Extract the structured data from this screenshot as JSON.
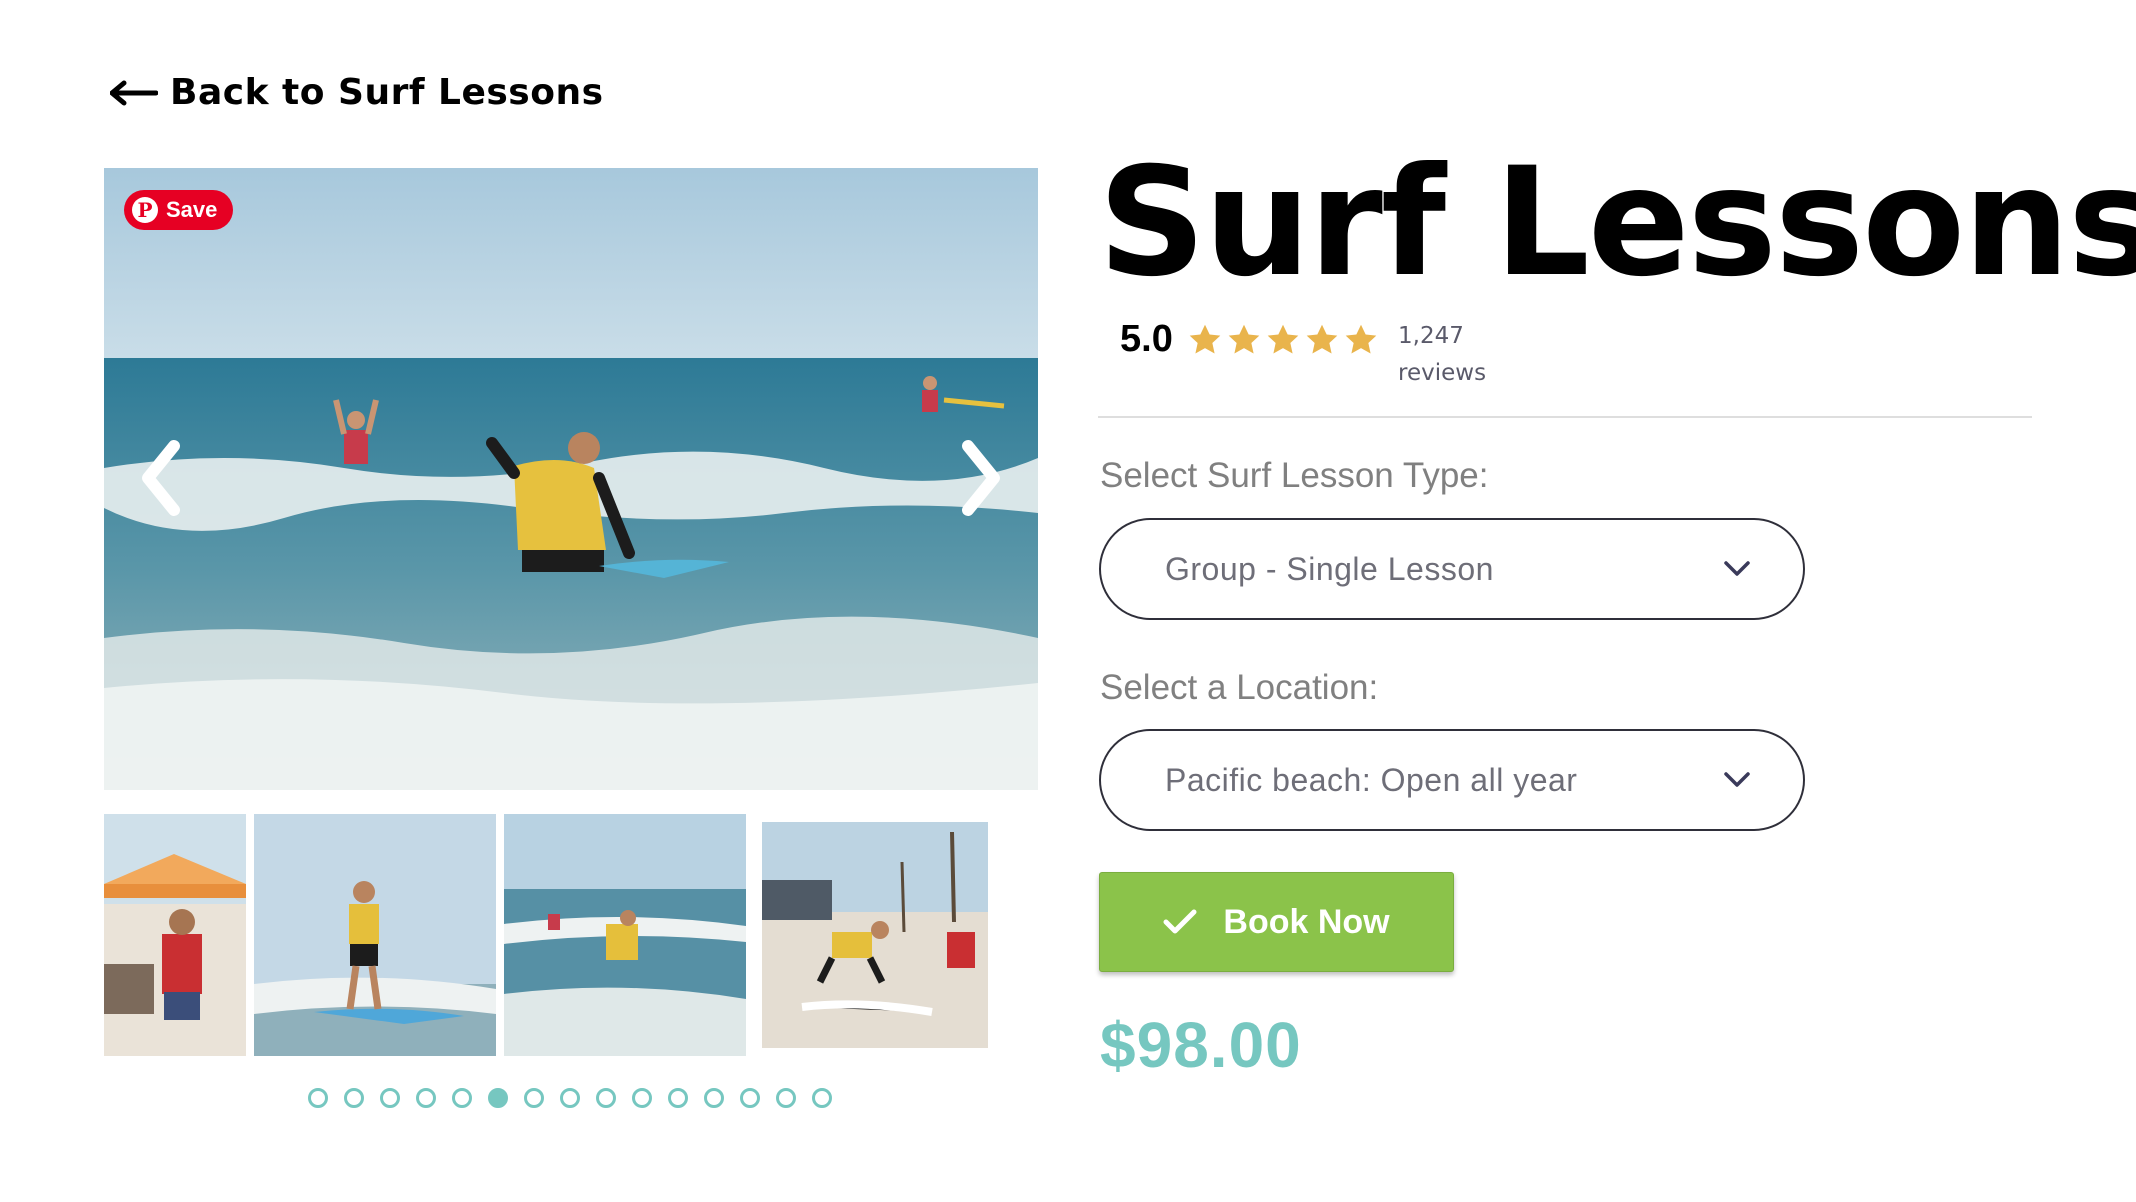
{
  "nav": {
    "back_label": "Back to Surf Lessons"
  },
  "gallery": {
    "pinterest_save_label": "Save",
    "dot_count": 15,
    "active_dot": 5
  },
  "product": {
    "title": "Surf Lessons",
    "rating_score": "5.0",
    "stars": 5,
    "review_count": "1,247",
    "review_word": "reviews"
  },
  "options": {
    "lesson_type_label": "Select Surf Lesson Type:",
    "lesson_type_value": "Group - Single Lesson",
    "location_label": "Select a Location:",
    "location_value": "Pacific beach: Open all year"
  },
  "actions": {
    "book_label": "Book Now"
  },
  "price": "$98.00",
  "colors": {
    "accent_teal": "#76c7c0",
    "book_green": "#8bc34a",
    "star_gold": "#e9b44c",
    "pinterest_red": "#e60023"
  }
}
